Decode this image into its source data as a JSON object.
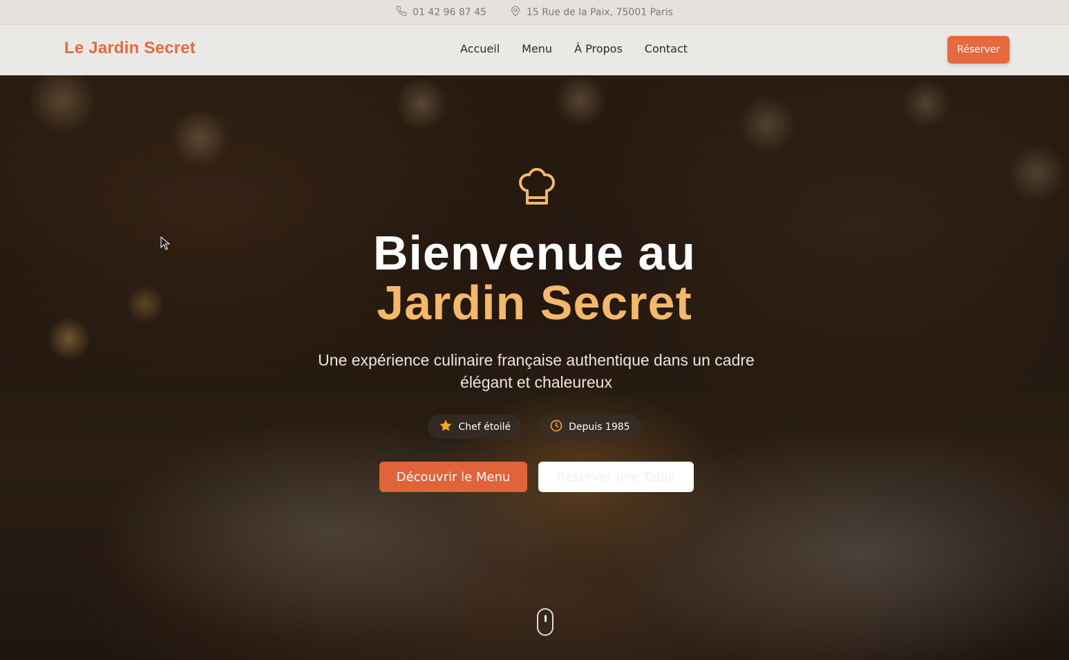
{
  "topbar": {
    "phone": "01 42 96 87 45",
    "phone_icon": "phone-icon",
    "address": "15 Rue de la Paix, 75001 Paris",
    "address_icon": "map-pin-icon"
  },
  "nav": {
    "logo": "Le Jardin Secret",
    "links": [
      "Accueil",
      "Menu",
      "À Propos",
      "Contact"
    ],
    "reserve_label": "Réserver"
  },
  "hero": {
    "icon": "chef-hat-icon",
    "title_line1": "Bienvenue au",
    "title_line2": "Jardin Secret",
    "subtitle": "Une expérience culinaire française authentique dans un cadre élégant et chaleureux",
    "badges": [
      {
        "icon": "star-icon",
        "label": "Chef étoilé"
      },
      {
        "icon": "clock-icon",
        "label": "Depuis 1985"
      }
    ],
    "cta_primary": "Découvrir le Menu",
    "cta_secondary": "Réserver une Table",
    "scroll_icon": "mouse-scroll-icon"
  },
  "colors": {
    "accent": "#e56b3e",
    "title_highlight": "#f3b86a",
    "star": "#f5a623"
  }
}
